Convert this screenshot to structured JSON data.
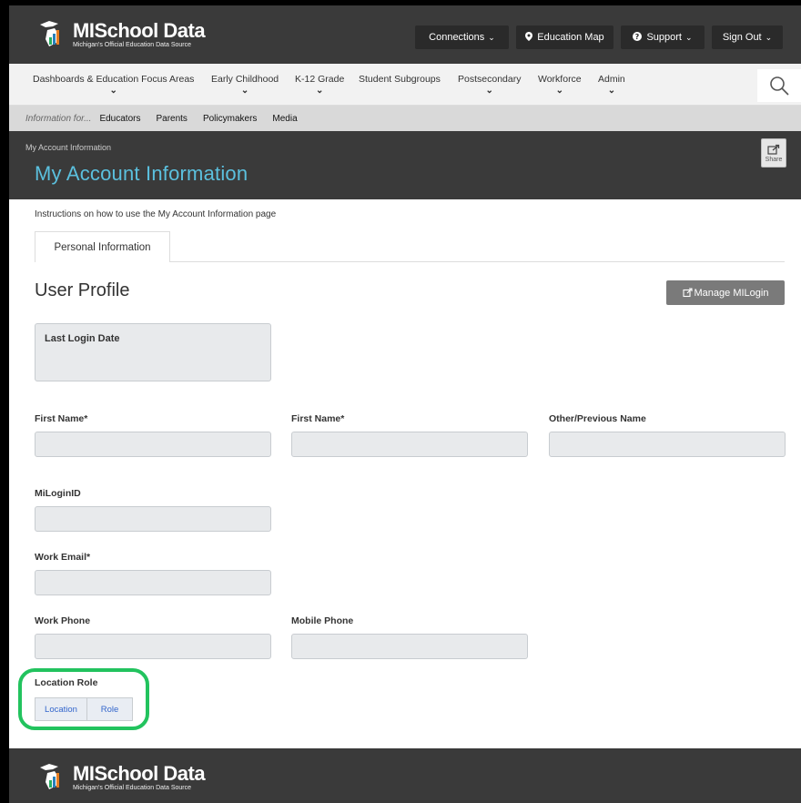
{
  "header": {
    "logo_title": "MISchool Data",
    "logo_subtitle": "Michigan's Official Education Data Source",
    "connections": "Connections",
    "education_map": "Education Map",
    "support": "Support",
    "sign_out": "Sign Out"
  },
  "nav": {
    "items": [
      {
        "label": "Dashboards & Education Focus Areas"
      },
      {
        "label": "Early Childhood"
      },
      {
        "label": "K-12 Grade"
      },
      {
        "label": "Student Subgroups"
      },
      {
        "label": "Postsecondary"
      },
      {
        "label": "Workforce"
      },
      {
        "label": "Admin"
      }
    ]
  },
  "audience": {
    "lead": "Information for...",
    "items": [
      "Educators",
      "Parents",
      "Policymakers",
      "Media"
    ]
  },
  "page": {
    "breadcrumb": "My Account Information",
    "title": "My Account Information",
    "share": "Share",
    "instructions": "Instructions on how to use the My Account Information page",
    "tab": "Personal Information",
    "section_title": "User Profile",
    "manage_button": "Manage MILogin",
    "last_login_label": "Last Login Date"
  },
  "fields": {
    "first_name_1": "First Name*",
    "first_name_2": "First Name*",
    "other_name": "Other/Previous Name",
    "milogin_id": "MiLoginID",
    "work_email": "Work Email*",
    "work_phone": "Work Phone",
    "mobile_phone": "Mobile Phone",
    "location_role": "Location Role",
    "location_tab": "Location",
    "role_tab": "Role"
  },
  "footer": {
    "logo_title": "MISchool Data",
    "logo_subtitle": "Michigan's Official Education Data Source"
  }
}
